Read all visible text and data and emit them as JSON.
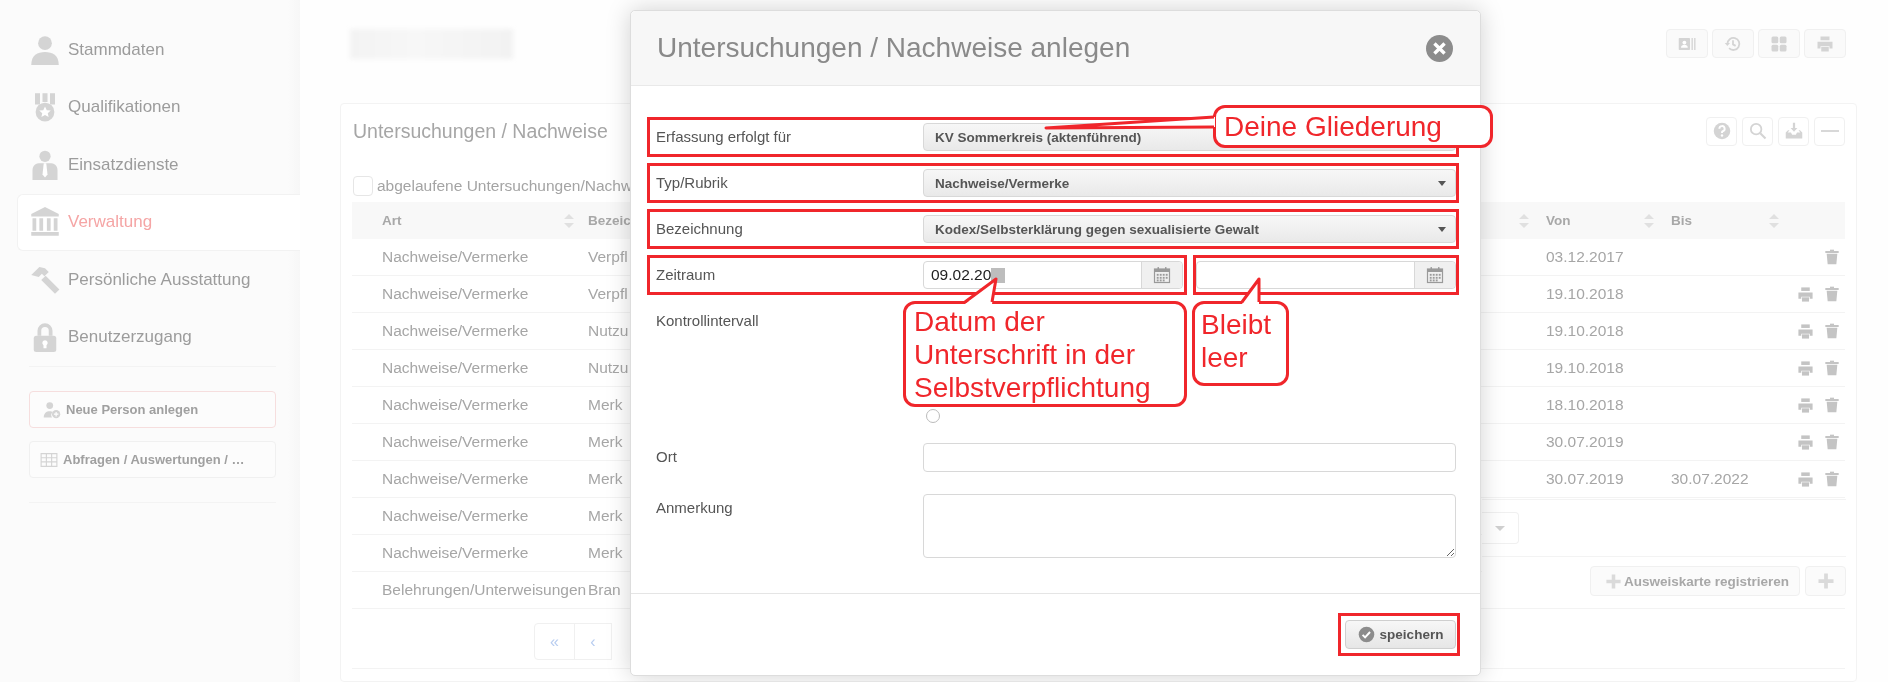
{
  "sidebar": {
    "items": [
      {
        "label": "Stammdaten",
        "selected": false
      },
      {
        "label": "Qualifikationen",
        "selected": false
      },
      {
        "label": "Einsatzdienste",
        "selected": false
      },
      {
        "label": "Verwaltung",
        "selected": true
      },
      {
        "label": "Persönliche Ausstattung",
        "selected": false
      },
      {
        "label": "Benutzerzugang",
        "selected": false
      }
    ],
    "buttons": [
      {
        "label": "Neue Person anlegen"
      },
      {
        "label": "Abfragen / Auswertungen / …"
      }
    ]
  },
  "panel": {
    "title": "Untersuchungen / Nachweise",
    "filter": {
      "label": "abgelaufene Untersuchungen/Nachw",
      "checked": false
    },
    "table": {
      "columns": [
        {
          "label": "Art"
        },
        {
          "label": "Bezeic"
        },
        {
          "label": "Von"
        },
        {
          "label": "Bis"
        }
      ],
      "rows": [
        {
          "art": "Nachweise/Vermerke",
          "bezeichnung": "Verpfl",
          "von": "03.12.2017",
          "print": false,
          "delete": true
        },
        {
          "art": "Nachweise/Vermerke",
          "bezeichnung": "Verpfl",
          "von": "19.10.2018",
          "print": true,
          "delete": true
        },
        {
          "art": "Nachweise/Vermerke",
          "bezeichnung": "Nutzu",
          "von": "19.10.2018",
          "print": true,
          "delete": true
        },
        {
          "art": "Nachweise/Vermerke",
          "bezeichnung": "Nutzu",
          "von": "19.10.2018",
          "print": true,
          "delete": true
        },
        {
          "art": "Nachweise/Vermerke",
          "bezeichnung": "Merk",
          "von": "18.10.2018",
          "print": true,
          "delete": true
        },
        {
          "art": "Nachweise/Vermerke",
          "bezeichnung": "Merk",
          "von": "30.07.2019",
          "print": true,
          "delete": true
        },
        {
          "art": "Nachweise/Vermerke",
          "bezeichnung": "Merk",
          "von": "30.07.2019",
          "bis": "30.07.2022",
          "print": true,
          "delete": true
        },
        {
          "art": "Nachweise/Vermerke",
          "bezeichnung": "Merk"
        },
        {
          "art": "Nachweise/Vermerke",
          "bezeichnung": "Merk"
        },
        {
          "art": "Belehrungen/Unterweisungen",
          "bezeichnung": "Bran"
        }
      ]
    },
    "pagination": [
      "«",
      "‹"
    ],
    "register_button": "Ausweiskarte registrieren"
  },
  "modal": {
    "title": "Untersuchungen / Nachweise anlegen",
    "fields": [
      {
        "kind": "static",
        "label": "Erfassung erfolgt für",
        "value": "KV Sommerkreis (aktenführend)",
        "highlighted": true
      },
      {
        "kind": "select",
        "label": "Typ/Rubrik",
        "value": "Nachweise/Vermerke",
        "highlighted": true
      },
      {
        "kind": "select",
        "label": "Bezeichnung",
        "value": "Kodex/Selbsterklärung gegen sexualisierte Gewalt",
        "highlighted": true
      },
      {
        "kind": "daterange",
        "label": "Zeitraum",
        "from": {
          "value": "09.02.20",
          "redacted": true,
          "highlighted": true
        },
        "to": {
          "highlighted": true
        }
      },
      {
        "kind": "radio",
        "label": "Kontrollintervall",
        "highlighted": false,
        "options": [
          {
            "selected": false
          }
        ]
      },
      {
        "kind": "text",
        "label": "Ort",
        "highlighted": false
      },
      {
        "kind": "textarea",
        "label": "Anmerkung",
        "highlighted": false
      }
    ],
    "save_button": {
      "label": "speichern",
      "highlighted": true
    },
    "annotations": [
      {
        "text": "Deine Gliederung"
      },
      {
        "text": "Datum der Unterschrift in der Selbstverpflichtung"
      },
      {
        "text": "Bleibt leer"
      }
    ]
  }
}
